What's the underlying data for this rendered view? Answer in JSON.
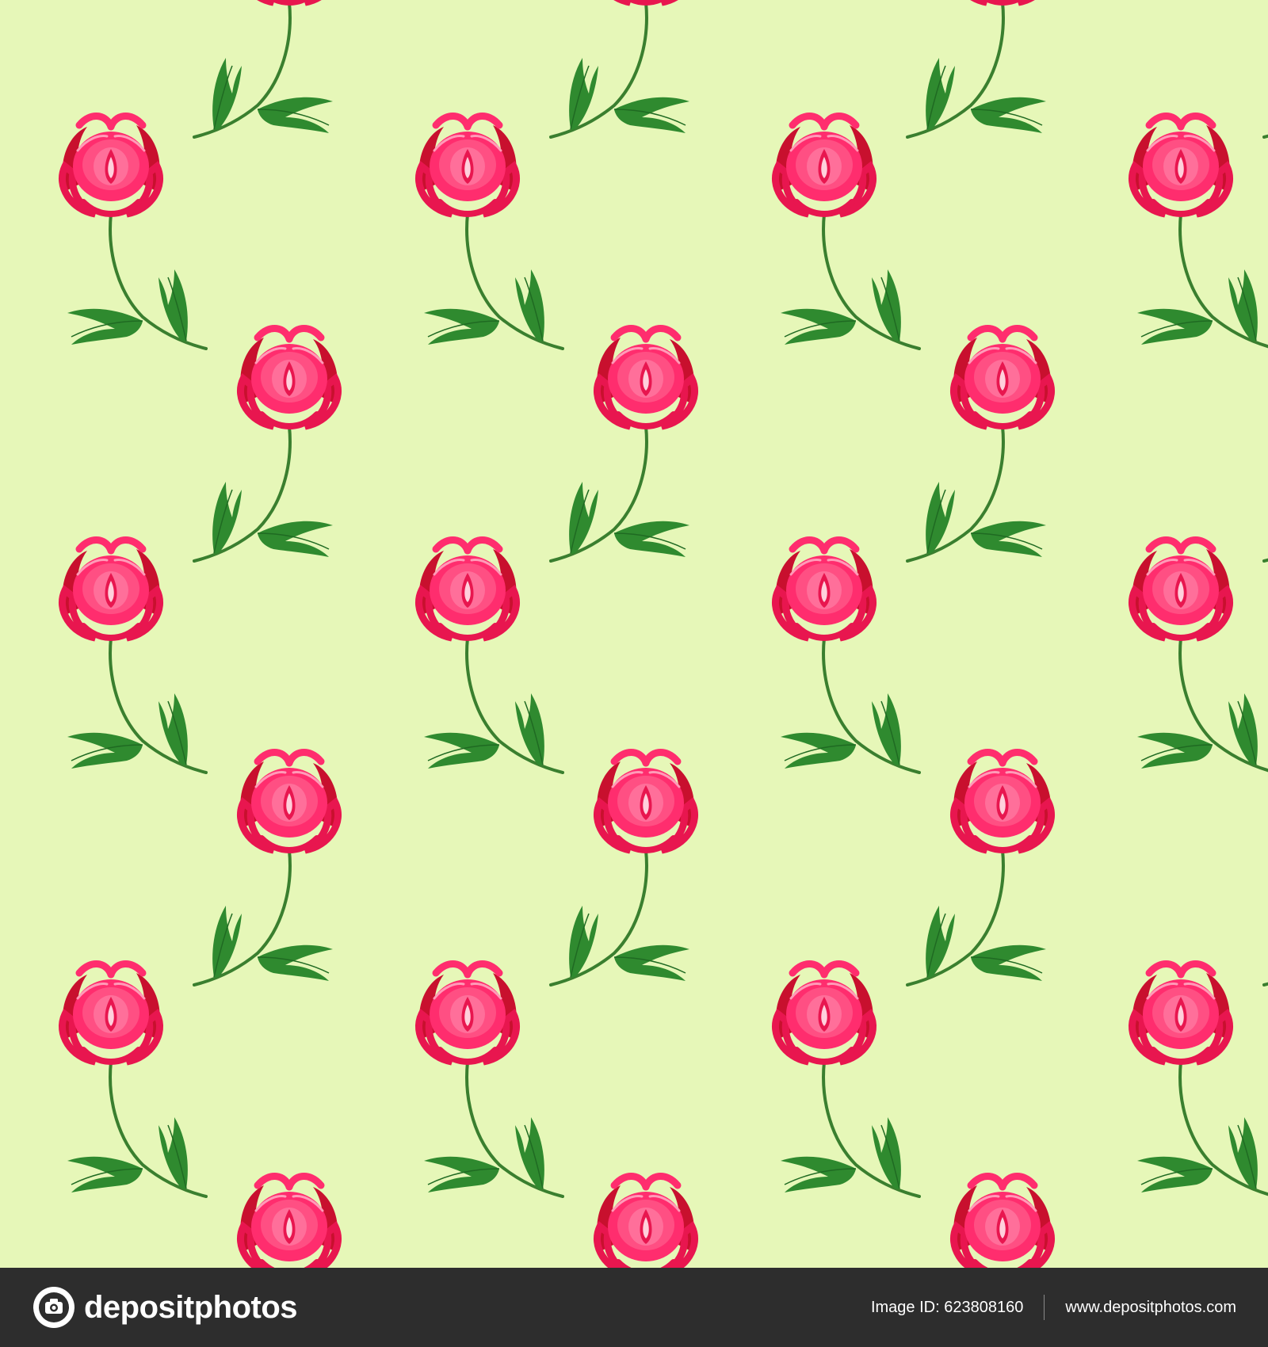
{
  "pattern": {
    "background_color": "#e6f7b8",
    "petal_colors": [
      "#ff2d6e",
      "#e8164f",
      "#ff6f9a",
      "#c8102e"
    ],
    "leaf_color": "#2f8a2f",
    "stem_color": "#3a7f2f",
    "motif": "pink-flower-with-green-leaves"
  },
  "footer": {
    "brand_name": "depositphotos",
    "image_id": "Image ID: 623808160",
    "site_url": "www.depositphotos.com",
    "background_color": "#2d2d2d"
  }
}
